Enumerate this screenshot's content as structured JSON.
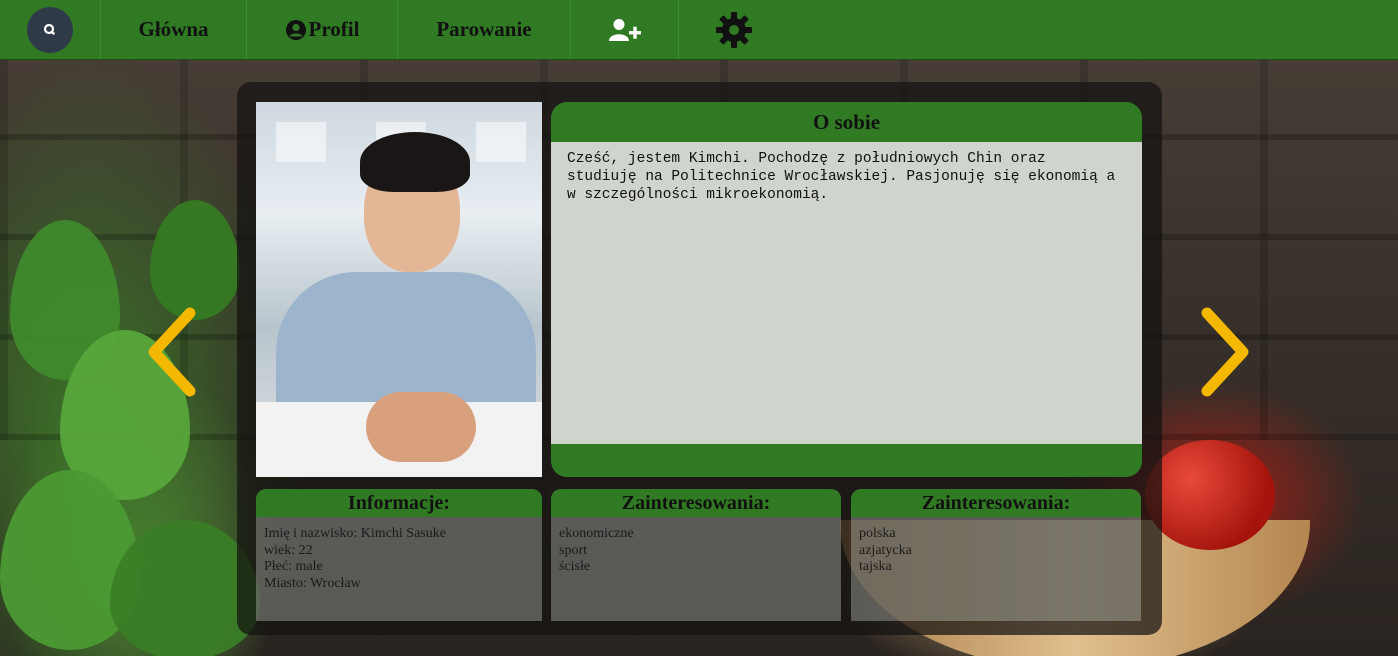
{
  "nav": {
    "search_icon": "search-icon",
    "main_label": "Główna",
    "profile_label": "Profil",
    "profile_icon": "user-circle-icon",
    "pairing_label": "Parowanie",
    "add_user_icon": "user-plus-icon",
    "settings_icon": "gear-icon"
  },
  "profile": {
    "about_title": "O sobie",
    "about_text": "Cześć, jestem Kimchi. Pochodzę z południowych Chin oraz\nstudiuję na Politechnice Wrocławskiej. Pasjonuję się ekonomią a\nw szczególności mikroekonomią.",
    "info_title": "Informacje:",
    "info_lines": [
      "Imię i nazwisko: Kimchi Sasuke",
      "wiek: 22",
      "Płeć: male",
      "Miasto: Wrocław"
    ],
    "interests_title": "Zainteresowania:",
    "interests": [
      "ekonomiczne",
      "sport",
      "ścisłe"
    ],
    "cuisine_title": "Zainteresowania:",
    "cuisines": [
      "polska",
      "azjatycka",
      "tajska"
    ]
  },
  "controls": {
    "prev_icon": "chevron-left-icon",
    "next_icon": "chevron-right-icon"
  },
  "colors": {
    "nav_green": "#2f7a22",
    "arrow_yellow": "#f5b800",
    "text_area": "#cfd4cc"
  }
}
